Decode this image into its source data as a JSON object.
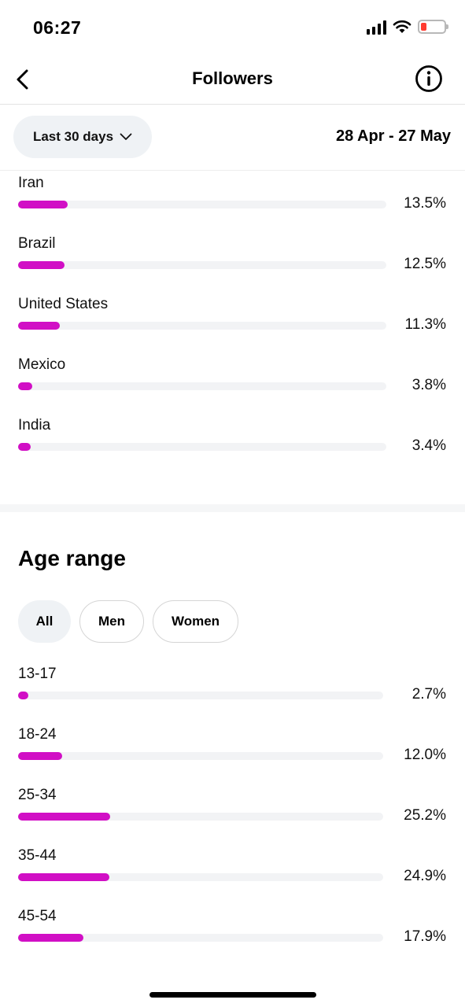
{
  "status_bar": {
    "time": "06:27"
  },
  "nav": {
    "title": "Followers"
  },
  "filter": {
    "period_label": "Last 30 days",
    "date_range": "28 Apr - 27 May"
  },
  "countries": [
    {
      "label": "Iran",
      "percent": "13.5%",
      "fraction": 0.135
    },
    {
      "label": "Brazil",
      "percent": "12.5%",
      "fraction": 0.125
    },
    {
      "label": "United States",
      "percent": "11.3%",
      "fraction": 0.113
    },
    {
      "label": "Mexico",
      "percent": "3.8%",
      "fraction": 0.038
    },
    {
      "label": "India",
      "percent": "3.4%",
      "fraction": 0.034
    }
  ],
  "age_range": {
    "title": "Age range",
    "chips": [
      {
        "label": "All",
        "selected": true
      },
      {
        "label": "Men",
        "selected": false
      },
      {
        "label": "Women",
        "selected": false
      }
    ],
    "items": [
      {
        "label": "13-17",
        "percent": "2.7%",
        "fraction": 0.027
      },
      {
        "label": "18-24",
        "percent": "12.0%",
        "fraction": 0.12
      },
      {
        "label": "25-34",
        "percent": "25.2%",
        "fraction": 0.252
      },
      {
        "label": "35-44",
        "percent": "24.9%",
        "fraction": 0.249
      },
      {
        "label": "45-54",
        "percent": "17.9%",
        "fraction": 0.179
      }
    ]
  },
  "colors": {
    "bar_fill": "#d10fc5",
    "bar_track": "#f2f3f5",
    "pill_bg": "#eff2f5",
    "battery_low": "#ff3b30"
  },
  "icons": [
    "signal-icon",
    "wifi-icon",
    "battery-icon",
    "back-chevron-icon",
    "info-icon",
    "chevron-down-icon"
  ]
}
